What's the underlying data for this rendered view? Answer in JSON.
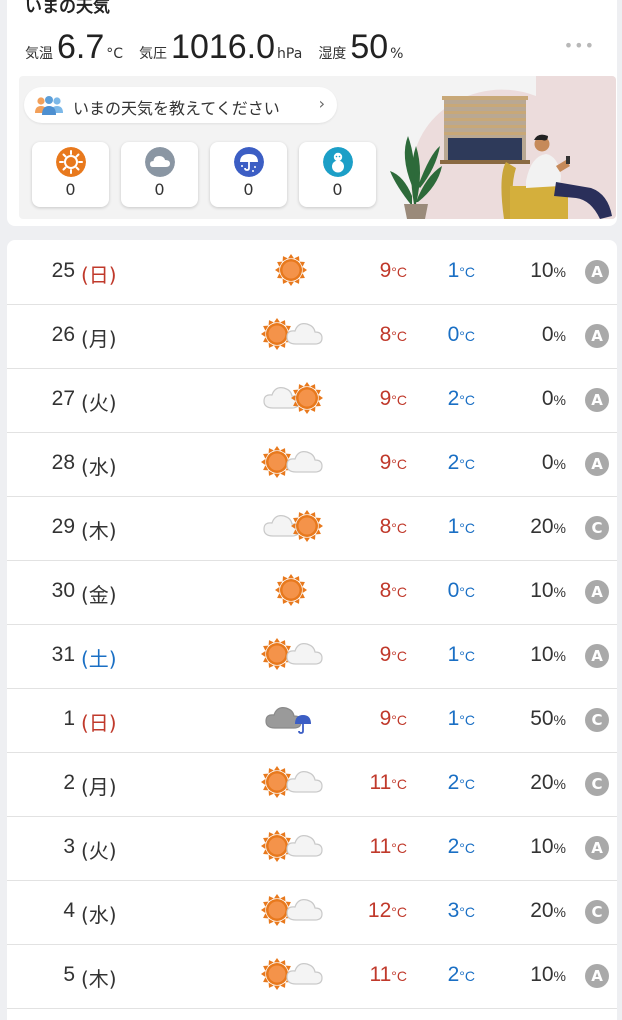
{
  "now": {
    "title": "いまの天気",
    "temp_label": "気温",
    "temp_value": "6.7",
    "temp_unit": "°C",
    "pressure_label": "気圧",
    "pressure_value": "1016.0",
    "pressure_unit": "hPa",
    "humidity_label": "湿度",
    "humidity_value": "50",
    "humidity_unit": "%",
    "more_icon": "ellipsis-icon"
  },
  "report": {
    "prompt": "いまの天気を教えてください",
    "buttons": [
      {
        "name": "sunny-report",
        "icon": "sun-icon",
        "count": "0",
        "color": "#e8791d"
      },
      {
        "name": "cloudy-report",
        "icon": "cloud-icon",
        "count": "0",
        "color": "#8a96a3"
      },
      {
        "name": "rainy-report",
        "icon": "umbrella-icon",
        "count": "0",
        "color": "#3c5ec4"
      },
      {
        "name": "snowy-report",
        "icon": "snowman-icon",
        "count": "0",
        "color": "#1c9fc7"
      }
    ]
  },
  "forecast": [
    {
      "day": "25",
      "weekday": "(日)",
      "type": "sun",
      "weather": "sunny",
      "hi": "9",
      "lo": "1",
      "pop": "10",
      "rank": "A"
    },
    {
      "day": "26",
      "weekday": "(月)",
      "type": "wk",
      "weather": "sunny-then-cloudy",
      "hi": "8",
      "lo": "0",
      "pop": "0",
      "rank": "A"
    },
    {
      "day": "27",
      "weekday": "(火)",
      "type": "wk",
      "weather": "cloudy-then-sunny",
      "hi": "9",
      "lo": "2",
      "pop": "0",
      "rank": "A"
    },
    {
      "day": "28",
      "weekday": "(水)",
      "type": "wk",
      "weather": "sunny-then-cloudy",
      "hi": "9",
      "lo": "2",
      "pop": "0",
      "rank": "A"
    },
    {
      "day": "29",
      "weekday": "(木)",
      "type": "wk",
      "weather": "cloudy-then-sunny",
      "hi": "8",
      "lo": "1",
      "pop": "20",
      "rank": "C"
    },
    {
      "day": "30",
      "weekday": "(金)",
      "type": "wk",
      "weather": "sunny",
      "hi": "8",
      "lo": "0",
      "pop": "10",
      "rank": "A"
    },
    {
      "day": "31",
      "weekday": "(土)",
      "type": "sat",
      "weather": "sunny-then-cloudy",
      "hi": "9",
      "lo": "1",
      "pop": "10",
      "rank": "A"
    },
    {
      "day": "1",
      "weekday": "(日)",
      "type": "sun",
      "weather": "cloudy-then-rain",
      "hi": "9",
      "lo": "1",
      "pop": "50",
      "rank": "C"
    },
    {
      "day": "2",
      "weekday": "(月)",
      "type": "wk",
      "weather": "sunny-then-cloudy",
      "hi": "11",
      "lo": "2",
      "pop": "20",
      "rank": "C"
    },
    {
      "day": "3",
      "weekday": "(火)",
      "type": "wk",
      "weather": "sunny-then-cloudy",
      "hi": "11",
      "lo": "2",
      "pop": "10",
      "rank": "A"
    },
    {
      "day": "4",
      "weekday": "(水)",
      "type": "wk",
      "weather": "sunny-then-cloudy",
      "hi": "12",
      "lo": "3",
      "pop": "20",
      "rank": "C"
    },
    {
      "day": "5",
      "weekday": "(木)",
      "type": "wk",
      "weather": "sunny-then-cloudy",
      "hi": "11",
      "lo": "2",
      "pop": "10",
      "rank": "A"
    }
  ],
  "units": {
    "temp": "°C",
    "pct": "%"
  }
}
